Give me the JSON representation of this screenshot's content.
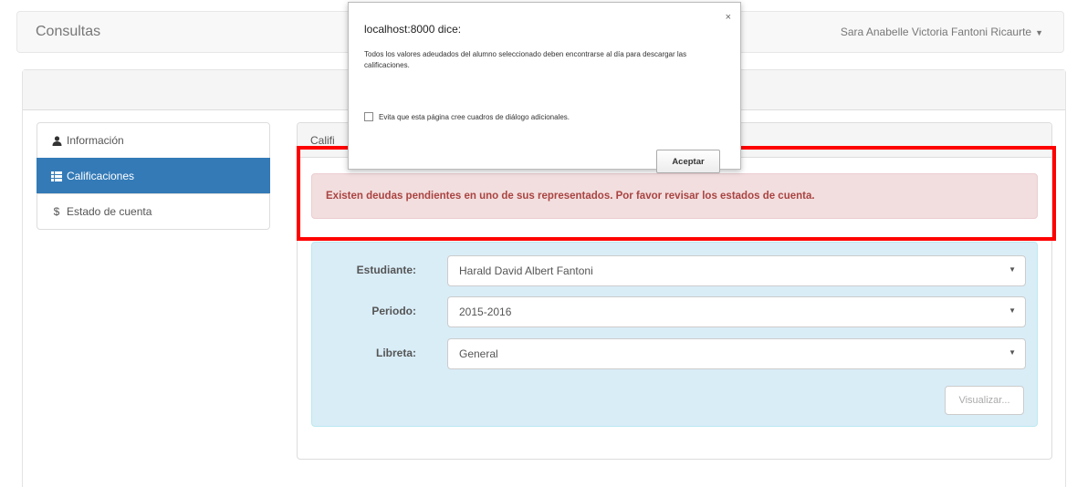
{
  "navbar": {
    "brand": "Consultas",
    "user_name": "Sara Anabelle Victoria Fantoni Ricaurte"
  },
  "sidebar": {
    "items": [
      {
        "label": "Información",
        "icon": "user-icon",
        "active": false
      },
      {
        "label": "Calificaciones",
        "icon": "list-icon",
        "active": true
      },
      {
        "label": "Estado de cuenta",
        "icon": "dollar-icon",
        "active": false
      }
    ]
  },
  "panel": {
    "heading": "Califi"
  },
  "alert": {
    "message": "Existen deudas pendientes en uno de sus representados. Por favor revisar los estados de cuenta.",
    "color": "#a94442"
  },
  "form": {
    "estudiante_label": "Estudiante:",
    "estudiante_value": "Harald David Albert Fantoni",
    "periodo_label": "Periodo:",
    "periodo_value": "2015-2016",
    "libreta_label": "Libreta:",
    "libreta_value": "General",
    "submit_label": "Visualizar..."
  },
  "dialog": {
    "title": "localhost:8000 dice:",
    "close": "×",
    "message": "Todos los valores adeudados del alumno seleccionado deben encontrarse al día para descargar las calificaciones.",
    "checkbox_label": "Evita que esta página cree cuadros de diálogo adicionales.",
    "accept_label": "Aceptar"
  },
  "colors": {
    "primary": "#337ab7",
    "alert_bg": "#f2dede",
    "well_bg": "#d9edf7",
    "highlight": "#ff0000"
  }
}
